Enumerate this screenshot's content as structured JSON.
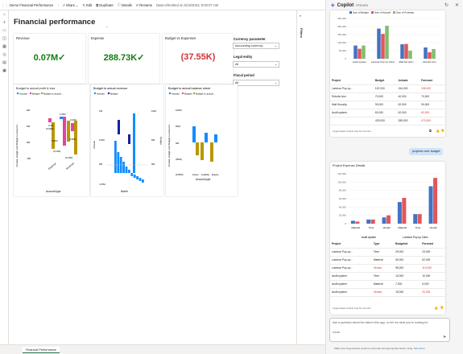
{
  "topbar": {
    "app": "Demo Financial Performance",
    "share": "Share",
    "edit": "Edit",
    "duplicate": "Duplicate",
    "details": "Details",
    "rename": "Rename",
    "refreshed": "Data refreshed on 6/15/2023, 8:00:07 AM"
  },
  "page": {
    "title": "Financial performance",
    "filters_label": "Filters",
    "tab": "Financial Performance",
    "chevron": "⌃"
  },
  "kpis": [
    {
      "title": "Revenue",
      "value": "0.07M",
      "mark": "✓",
      "color": "#107c10"
    },
    {
      "title": "Expense",
      "value": "288.73K",
      "mark": "✓",
      "color": "#107c10"
    },
    {
      "title": "Budget vs Expenses",
      "value": "(37.55K)",
      "mark": "",
      "color": "#d13438"
    }
  ],
  "slicers": [
    {
      "label": "Currency parameter",
      "value": "Accounting currency"
    },
    {
      "label": "Legal entity",
      "value": "All"
    },
    {
      "label": "Fiscal period",
      "value": "All"
    }
  ],
  "legend_common": {
    "actuals": "Actuals",
    "budget": "Budget",
    "budget_to_actual": "Budget to actual ..."
  },
  "colors": {
    "actuals": "#118dff",
    "budget": "#e044a7",
    "bta": "#b89800",
    "revenue_series": "#118dff",
    "budget_series": "#12239e",
    "copilot_budget": "#4472c4",
    "copilot_actuals": "#e15759",
    "copilot_forecast": "#7fbf6f"
  },
  "chart_data": [
    {
      "type": "bar",
      "title": "Budget to actual profit & loss",
      "ylabel": "Actuals, budget and Budget to actual re...",
      "xlabel": "Account type",
      "categories": [
        "Expense",
        "Revenue"
      ],
      "ticks": [
        "6M",
        "5M",
        "0M",
        "-5M",
        "(5M)"
      ],
      "data_labels": [
        "0.34M",
        "0.41M",
        "0.1M",
        "(0.22M)",
        "0.02M",
        "(0.8M)",
        "(6.12M)",
        "(6.22M)"
      ],
      "series": [
        {
          "name": "Actuals",
          "values": [
            null,
            0.1
          ]
        },
        {
          "name": "Budget",
          "values": [
            0.34,
            0.41
          ]
        },
        {
          "name": "Budget to actual",
          "values": [
            null,
            null
          ]
        }
      ]
    },
    {
      "type": "bar",
      "title": "Budget to actual revenue",
      "ylabel": "Actuals",
      "ylabel2": "Budget",
      "xlabel": "Month",
      "ticks_left": [
        "1M",
        "0.5M",
        "0M",
        "-0.5M",
        "(0.5M)"
      ],
      "ticks_right": [
        "10M",
        "5M",
        "0M",
        "(5M)"
      ],
      "series": [
        {
          "name": "Actuals"
        },
        {
          "name": "Budget"
        }
      ]
    },
    {
      "type": "bar",
      "title": "Budget to actual balance sheet",
      "ylabel": "Actuals, budget and Budget to actual re...",
      "xlabel": "Account type",
      "categories": [
        "Asset",
        "Liability",
        "Equity"
      ],
      "ticks": [
        "100M",
        "50M",
        "0M",
        "(50M)",
        "(100M)"
      ],
      "series": [
        {
          "name": "Actuals"
        },
        {
          "name": "Budget"
        },
        {
          "name": "Budget to actual"
        }
      ]
    }
  ],
  "copilot": {
    "title": "Copilot",
    "preview": "PREVIEW",
    "chart1": {
      "legend": [
        "Sum of Budget",
        "Sum of Actuals",
        "Sum of Forecast"
      ],
      "ticks": [
        "250,000",
        "200,000",
        "150,000",
        "100,000",
        "50,000",
        "0"
      ],
      "categories": [
        "Audit system",
        "Laminar Pop up Clinic",
        "Mall Security*",
        "Robotic Arm"
      ],
      "chart_data": {
        "type": "bar",
        "categories": [
          "Audit system",
          "Laminar Pop up Clinic",
          "Mall Security*",
          "Robotic Arm"
        ],
        "series": [
          {
            "name": "Sum of Budget",
            "values": [
              82000,
              187000,
              90000,
              70000
            ]
          },
          {
            "name": "Sum of Actuals",
            "values": [
              62000,
              154000,
              92000,
              40000
            ]
          },
          {
            "name": "Sum of Forecast",
            "values": [
              82000,
              205000,
              50000,
              60000
            ]
          }
        ]
      }
    },
    "table1": {
      "headers": [
        "Project",
        "Budget",
        "Actuals",
        "Forecast"
      ],
      "rows": [
        [
          "Laminar Pop up...",
          "187,000",
          "154,000",
          "195,000"
        ],
        [
          "Robotic Arm",
          "70,000",
          "40,000",
          "70,000"
        ],
        [
          "Mall Security",
          "90,000",
          "62,000",
          "90,000"
        ],
        [
          "Audit system",
          "82,000",
          "62,000",
          "82,000"
        ]
      ],
      "total": [
        "",
        "429,000",
        "289,000",
        "472,000"
      ]
    },
    "disclaimer": "AI-generated content may be incorrect",
    "user_msg": "projects over budget",
    "card2_title": "Project Expense Details",
    "chart2": {
      "ticks": [
        "120,000",
        "100,000",
        "80,000",
        "60,000",
        "40,000",
        "20,000",
        "0"
      ],
      "sub": [
        "Material",
        "Time",
        "Vendor",
        "Material",
        "Time",
        "Vendor"
      ],
      "groups": [
        "Audit system",
        "Laminar Pop up Clinic"
      ],
      "chart_data": {
        "type": "bar",
        "categories": [
          "Material",
          "Time",
          "Vendor",
          "Material",
          "Time",
          "Vendor"
        ],
        "series": [
          {
            "name": "Budgeted",
            "values": [
              7000,
              10000,
              15000,
              52000,
              23000,
              90000
            ]
          },
          {
            "name": "Forecast",
            "values": [
              5000,
              10000,
              20000,
              62000,
              23000,
              110000
            ]
          }
        ]
      }
    },
    "table2": {
      "headers": [
        "Project",
        "Type",
        "Budgeted",
        "Forecast"
      ],
      "rows": [
        [
          "Laminar Pop up...",
          "Time",
          "25,000",
          "23,000"
        ],
        [
          "Laminar Pop up...",
          "Material",
          "50,000",
          "62,000"
        ],
        [
          "Laminar Pop up...",
          "Vendor",
          "95,000",
          "110,000"
        ],
        [
          "Audit system",
          "Time",
          "10,000",
          "10,000"
        ],
        [
          "Audit system",
          "Material",
          "7,000",
          "5,000"
        ],
        [
          "Audit system",
          "Vendor",
          "15,000",
          "20,000"
        ]
      ]
    },
    "input_placeholder": "Ask a question about the data in this app, or tell me what you're looking for",
    "char_count": "0/2000",
    "footer": "Make sure AI-generated content is accurate and appropriate before using.",
    "see_terms": "See terms"
  }
}
